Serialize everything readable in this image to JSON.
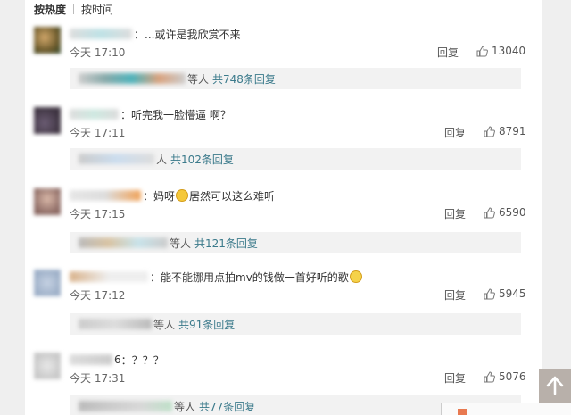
{
  "sort": {
    "hot": "按热度",
    "time": "按时间"
  },
  "comments": [
    {
      "text": "...或许是我欣赏不来",
      "time": "今天 17:10",
      "reply": "回复",
      "likes": "13040",
      "sub": {
        "suffix": "等人",
        "count": "共748条回复"
      }
    },
    {
      "text": "听完我一脸懵逼 啊？",
      "time": "今天 17:11",
      "reply": "回复",
      "likes": "8791",
      "sub": {
        "suffix": "人",
        "count": "共102条回复"
      }
    },
    {
      "text_a": "妈呀",
      "text_b": "居然可以这么难听",
      "time": "今天 17:15",
      "reply": "回复",
      "likes": "6590",
      "sub": {
        "suffix": "等人",
        "count": "共121条回复"
      }
    },
    {
      "text": "能不能挪用点拍mv的钱做一首好听的歌",
      "time": "今天 17:12",
      "reply": "回复",
      "likes": "5945",
      "sub": {
        "suffix": "等人",
        "count": "共91条回复"
      }
    },
    {
      "name_tail": "6",
      "text": "？？？",
      "time": "今天 17:31",
      "reply": "回复",
      "likes": "5076",
      "sub": {
        "suffix": "等人",
        "count": "共77条回复"
      }
    }
  ]
}
